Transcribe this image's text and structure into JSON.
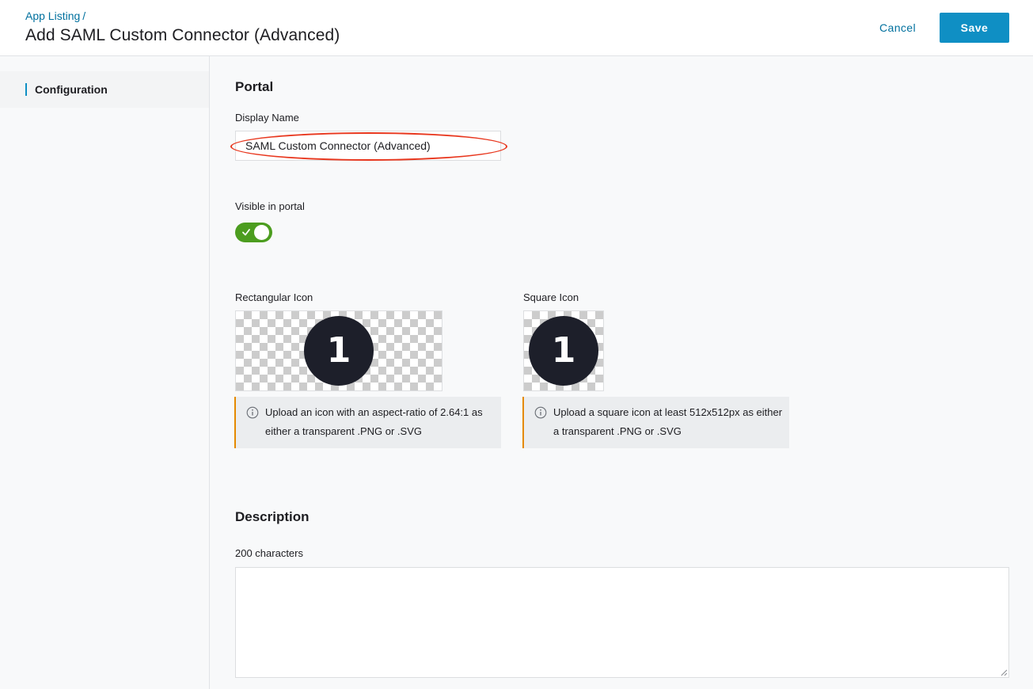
{
  "header": {
    "breadcrumb": "App Listing",
    "breadcrumb_separator": "/",
    "title": "Add SAML Custom Connector (Advanced)",
    "cancel_label": "Cancel",
    "save_label": "Save"
  },
  "sidebar": {
    "items": [
      {
        "label": "Configuration",
        "active": true
      }
    ]
  },
  "portal": {
    "section_title": "Portal",
    "display_name_label": "Display Name",
    "display_name_value": "SAML Custom Connector (Advanced)",
    "visible_label": "Visible in portal",
    "visible_on": true,
    "rect_icon_label": "Rectangular Icon",
    "square_icon_label": "Square Icon",
    "icon_glyph": "1",
    "rect_icon_hint": "Upload an icon with an aspect-ratio of 2.64:1 as either a transparent .PNG or .SVG",
    "square_icon_hint": "Upload a square icon at least 512x512px as either a transparent .PNG or .SVG"
  },
  "description": {
    "section_title": "Description",
    "limit_label": "200 characters",
    "value": ""
  },
  "colors": {
    "accent": "#0f8fc4",
    "link": "#00709e",
    "toggle_on": "#4c9d1f",
    "hint_border": "#e58a00",
    "annotation": "#e8371e"
  },
  "icons": {
    "toggle_check": "check-icon",
    "hint": "info-icon",
    "textarea_resize": "resize-handle-icon"
  }
}
